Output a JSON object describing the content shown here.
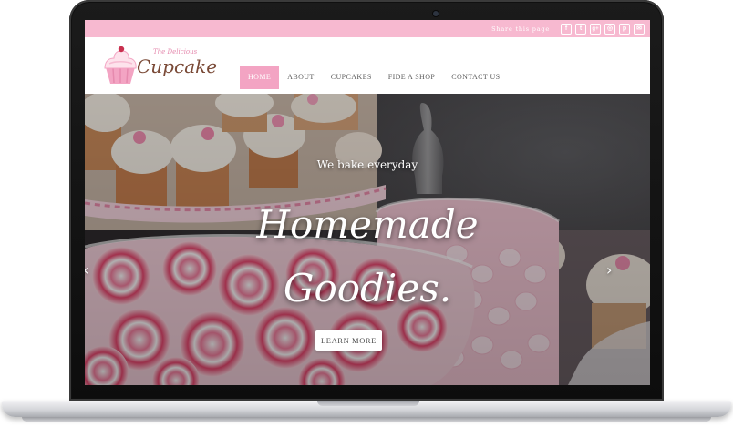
{
  "share_bar": {
    "label": "Share this page",
    "icons": [
      "facebook-icon",
      "twitter-icon",
      "google-plus-icon",
      "instagram-icon",
      "pinterest-icon",
      "email-icon"
    ],
    "glyphs": [
      "f",
      "t",
      "g+",
      "◎",
      "p",
      "✉"
    ]
  },
  "logo": {
    "tagline": "The Delicious",
    "name": "Cupcake"
  },
  "nav": {
    "items": [
      {
        "label": "HOME"
      },
      {
        "label": "ABOUT"
      },
      {
        "label": "CUPCAKES"
      },
      {
        "label": "FIDE A SHOP"
      },
      {
        "label": "CONTACT US"
      }
    ],
    "active_index": 0
  },
  "hero": {
    "kicker": "We bake everyday",
    "title_line1": "Homemade",
    "title_line2": "Goodies.",
    "button": "LEARN  MORE",
    "prev_arrow": "‹",
    "next_arrow": "›"
  },
  "colors": {
    "accent_pink": "#f3a4c3",
    "share_bar": "#f7b9d0",
    "logo_brown": "#7a4a37"
  }
}
